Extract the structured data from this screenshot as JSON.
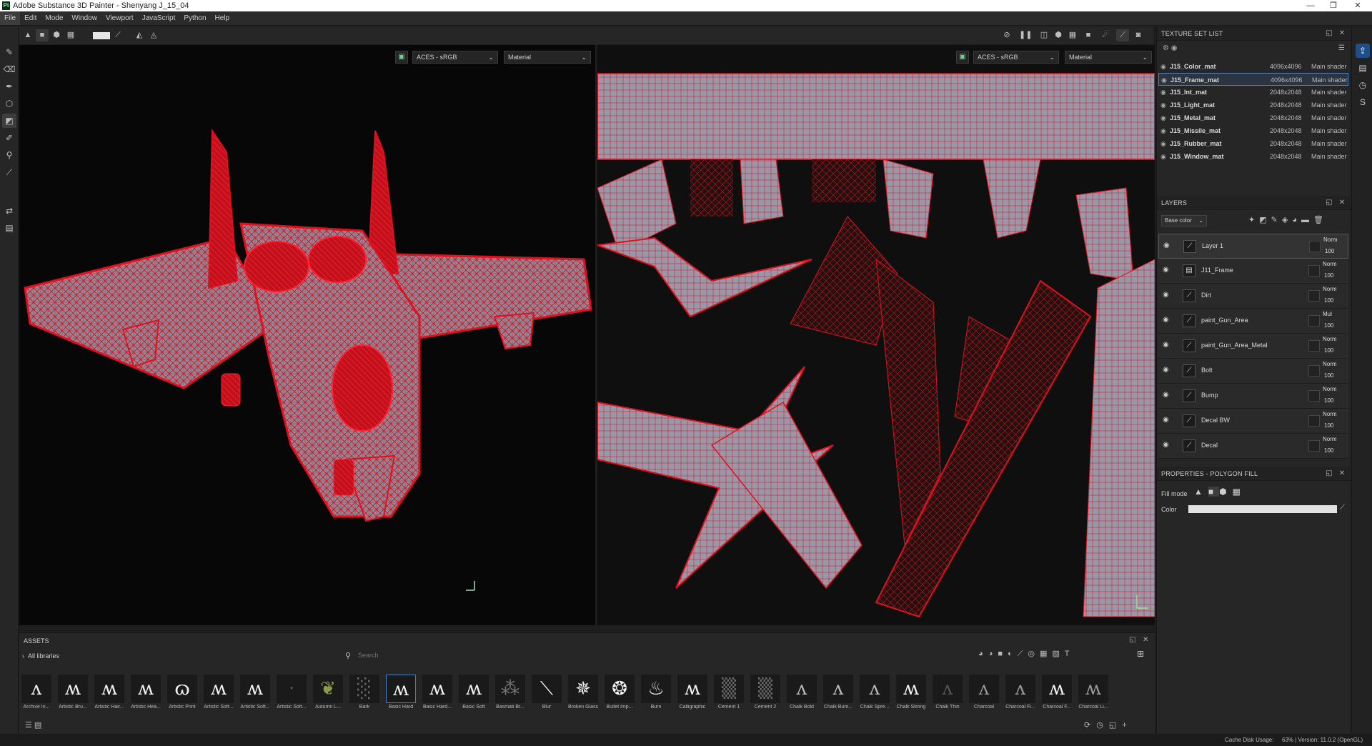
{
  "window": {
    "title": "Adobe Substance 3D Painter - Shenyang J_15_04",
    "logo": "Pt"
  },
  "menu": [
    "File",
    "Edit",
    "Mode",
    "Window",
    "Viewport",
    "JavaScript",
    "Python",
    "Help"
  ],
  "viewport3d": {
    "colorspace": "ACES - sRGB",
    "mode": "Material"
  },
  "viewport2d": {
    "colorspace": "ACES - sRGB",
    "mode": "Material"
  },
  "texture_set_list": {
    "title": "TEXTURE SET LIST",
    "items": [
      {
        "name": "J15_Color_mat",
        "size": "4096x4096",
        "shader": "Main shader"
      },
      {
        "name": "J15_Frame_mat",
        "size": "4096x4096",
        "shader": "Main shader"
      },
      {
        "name": "J15_Int_mat",
        "size": "2048x2048",
        "shader": "Main shader"
      },
      {
        "name": "J15_Light_mat",
        "size": "2048x2048",
        "shader": "Main shader"
      },
      {
        "name": "J15_Metal_mat",
        "size": "2048x2048",
        "shader": "Main shader"
      },
      {
        "name": "J15_Missile_mat",
        "size": "2048x2048",
        "shader": "Main shader"
      },
      {
        "name": "J15_Rubber_mat",
        "size": "2048x2048",
        "shader": "Main shader"
      },
      {
        "name": "J15_Window_mat",
        "size": "2048x2048",
        "shader": "Main shader"
      }
    ]
  },
  "layers": {
    "title": "LAYERS",
    "channel": "Base color",
    "items": [
      {
        "name": "Layer 1",
        "blend": "Norm",
        "opacity": "100"
      },
      {
        "name": "J11_Frame",
        "blend": "Norm",
        "opacity": "100"
      },
      {
        "name": "Dirt",
        "blend": "Norm",
        "opacity": "100"
      },
      {
        "name": "paint_Gun_Area",
        "blend": "Mul",
        "opacity": "100"
      },
      {
        "name": "paint_Gun_Area_Metal",
        "blend": "Norm",
        "opacity": "100"
      },
      {
        "name": "Bolt",
        "blend": "Norm",
        "opacity": "100"
      },
      {
        "name": "Bump",
        "blend": "Norm",
        "opacity": "100"
      },
      {
        "name": "Decal BW",
        "blend": "Norm",
        "opacity": "100"
      },
      {
        "name": "Decal",
        "blend": "Norm",
        "opacity": "100"
      }
    ]
  },
  "properties": {
    "title": "PROPERTIES - POLYGON FILL",
    "fill_mode_label": "Fill mode",
    "color_label": "Color"
  },
  "assets": {
    "title": "ASSETS",
    "library": "All libraries",
    "search_placeholder": "Search",
    "items": [
      "Archive In...",
      "Artistic Bru...",
      "Artistic Hair...",
      "Artistic Hea...",
      "Artistic Print",
      "Artistic Soft...",
      "Artistic Soft...",
      "Artistic Soft...",
      "Autumn L...",
      "Bark",
      "Basic Hard",
      "Basic Hard...",
      "Basic Soft",
      "Basmati Br...",
      "Blur",
      "Broken Glass",
      "Bullet Imp...",
      "Burn",
      "Calligraphic",
      "Cement 1",
      "Cement 2",
      "Chalk Bold",
      "Chalk Bum...",
      "Chalk Spre...",
      "Chalk Strong",
      "Chalk Thin",
      "Charcoal",
      "Charcoal Fi...",
      "Charcoal F...",
      "Charcoal Li..."
    ]
  },
  "status": {
    "cache": "Cache Disk Usage:",
    "usage": "63% | Version: 11.0.2 (OpenGL)"
  },
  "colors": {
    "accent": "#4a7fc4",
    "wire": "#e0101e",
    "panel": "#262626"
  }
}
